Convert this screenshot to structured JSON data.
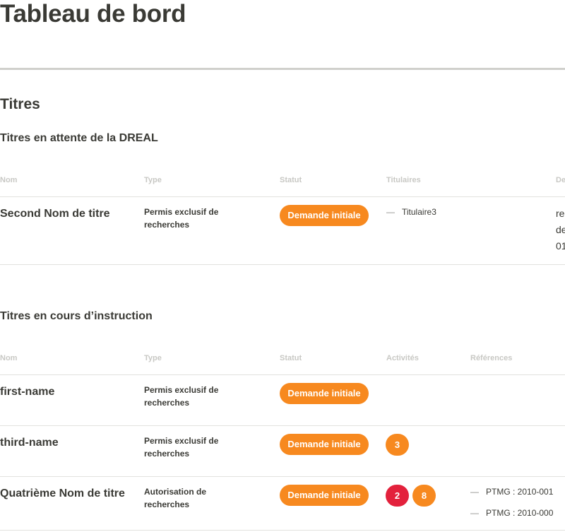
{
  "page": {
    "title": "Tableau de bord"
  },
  "titres": {
    "heading": "Titres",
    "attente": {
      "heading": "Titres en attente de la DREAL",
      "columns": [
        "Nom",
        "Type",
        "Statut",
        "Titulaires",
        "De"
      ],
      "rows": [
        {
          "nom": "Second Nom de titre",
          "type": "Permis exclusif de recherches",
          "statut": "Demande initiale",
          "titulaires": [
            "Titulaire3"
          ],
          "truncated_lines": [
            "re",
            "de",
            "01"
          ]
        }
      ]
    },
    "instruction": {
      "heading": "Titres en cours d’instruction",
      "columns": [
        "Nom",
        "Type",
        "Statut",
        "Activités",
        "Références"
      ],
      "rows": [
        {
          "nom": "first-name",
          "type": "Permis exclusif de recherches",
          "statut": "Demande initiale",
          "activites": [],
          "references": []
        },
        {
          "nom": "third-name",
          "type": "Permis exclusif de recherches",
          "statut": "Demande initiale",
          "activites": [
            {
              "count": "3",
              "color": "#f7891f"
            }
          ],
          "references": []
        },
        {
          "nom": "Quatrième Nom de titre",
          "type": "Autorisation de recherches",
          "statut": "Demande initiale",
          "activites": [
            {
              "count": "2",
              "color": "#e3213c"
            },
            {
              "count": "8",
              "color": "#f7891f"
            }
          ],
          "references": [
            "PTMG : 2010-001",
            "PTMG : 2010-000"
          ]
        }
      ]
    }
  },
  "colors": {
    "accent": "#f7891f",
    "alert": "#e3213c",
    "text": "#3a3a35"
  }
}
